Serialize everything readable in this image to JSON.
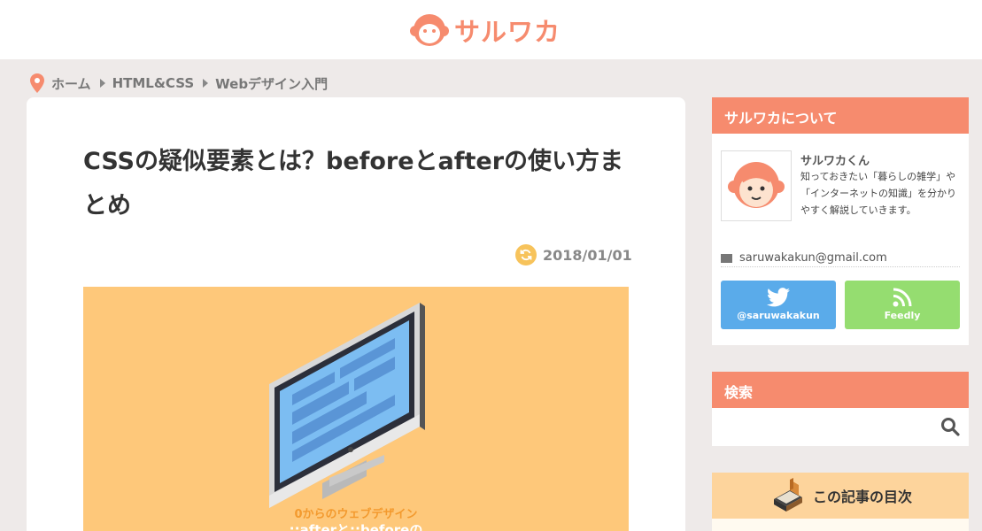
{
  "site": {
    "logo_text": "サルワカ"
  },
  "breadcrumb": {
    "items": [
      "ホーム",
      "HTML&CSS",
      "Webデザイン入門"
    ]
  },
  "article": {
    "title": "CSSの疑似要素とは？beforeとafterの使い方まとめ",
    "date": "2018/01/01",
    "eyecatch_caption_1": "0からのウェブデザイン",
    "eyecatch_caption_2": "::afterと::beforeの"
  },
  "about": {
    "heading": "サルワカについて",
    "name": "サルワカくん",
    "description": "知っておきたい「暮らしの雑学」や「インターネットの知識」を分かりやすく解説していきます。",
    "email": "saruwakakun@gmail.com",
    "twitter_label": "@saruwakakun",
    "feedly_label": "Feedly"
  },
  "search": {
    "heading": "検索",
    "placeholder": ""
  },
  "toc": {
    "heading": "この記事の目次"
  },
  "colors": {
    "accent": "#f68b6e",
    "background": "#eeeae9",
    "eyecatch": "#fec87a",
    "twitter": "#5aabea",
    "feedly": "#95dd70"
  }
}
